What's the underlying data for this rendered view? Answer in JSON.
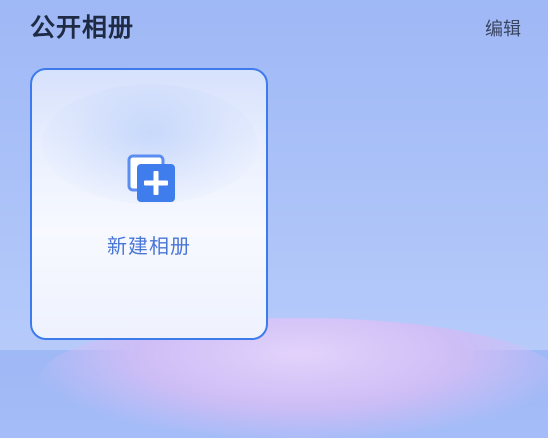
{
  "header": {
    "title": "公开相册",
    "edit_label": "编辑"
  },
  "album_card": {
    "label": "新建相册",
    "icon": "add-photo-icon"
  },
  "colors": {
    "accent": "#3d7bec",
    "label": "#4a76d6",
    "title": "#1f2a44"
  }
}
